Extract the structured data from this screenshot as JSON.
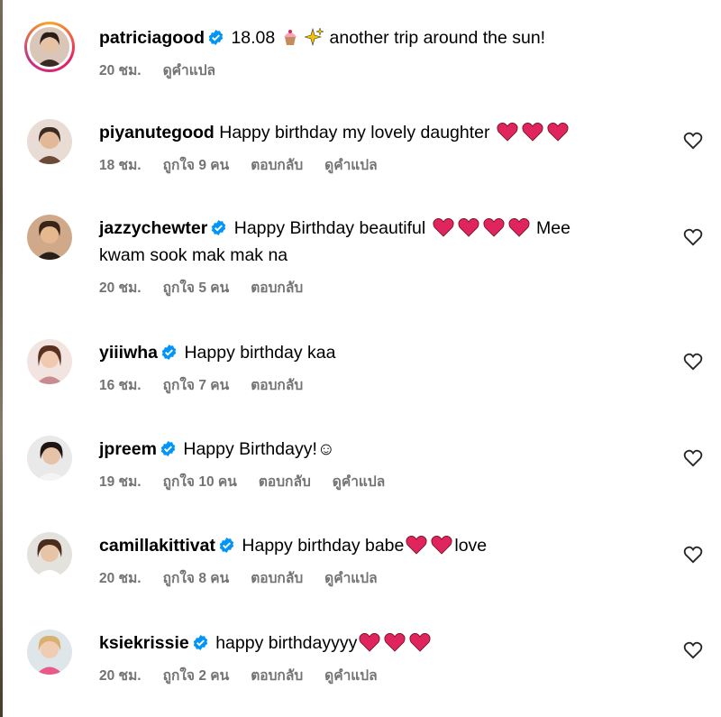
{
  "comments": [
    {
      "username": "patriciagood",
      "verified": true,
      "text_parts": [
        "18.08 ",
        "cupcake-emoji",
        "sparkles-emoji",
        " another trip around the sun!"
      ],
      "text_after": " another trip around the sun!",
      "text_before": "18.08",
      "time": "20 ชม.",
      "likes": "",
      "reply": "",
      "translate": "ดูคำแปล"
    },
    {
      "username": "piyanutegood",
      "verified": false,
      "text_before": "Happy birthday my lovely daughter",
      "hearts": 3,
      "time": "18 ชม.",
      "likes": "ถูกใจ 9 คน",
      "reply": "ตอบกลับ",
      "translate": "ดูคำแปล"
    },
    {
      "username": "jazzychewter",
      "verified": true,
      "text_before": "Happy Birthday beautiful",
      "hearts": 4,
      "text_after": "Mee",
      "text_line2": "kwam sook mak mak na",
      "time": "20 ชม.",
      "likes": "ถูกใจ 5 คน",
      "reply": "ตอบกลับ",
      "translate": ""
    },
    {
      "username": "yiiiwha",
      "verified": true,
      "text_before": "Happy birthday kaa",
      "time": "16 ชม.",
      "likes": "ถูกใจ 7 คน",
      "reply": "ตอบกลับ",
      "translate": ""
    },
    {
      "username": "jpreem",
      "verified": true,
      "text_before": "Happy Birthdayy!☺",
      "time": "19 ชม.",
      "likes": "ถูกใจ 10 คน",
      "reply": "ตอบกลับ",
      "translate": "ดูคำแปล"
    },
    {
      "username": "camillakittivat",
      "verified": true,
      "text_before": "Happy birthday babe",
      "hearts": 2,
      "text_after": "love",
      "time": "20 ชม.",
      "likes": "ถูกใจ 8 คน",
      "reply": "ตอบกลับ",
      "translate": "ดูคำแปล"
    },
    {
      "username": "ksiekrissie",
      "verified": true,
      "text_before": "happy birthdayyyy",
      "hearts": 3,
      "time": "20 ชม.",
      "likes": "ถูกใจ 2 คน",
      "reply": "ตอบกลับ",
      "translate": "ดูคำแปล"
    }
  ],
  "colors": {
    "verified": "#0095f6",
    "heart": "#e0245e",
    "meta": "#737373"
  }
}
